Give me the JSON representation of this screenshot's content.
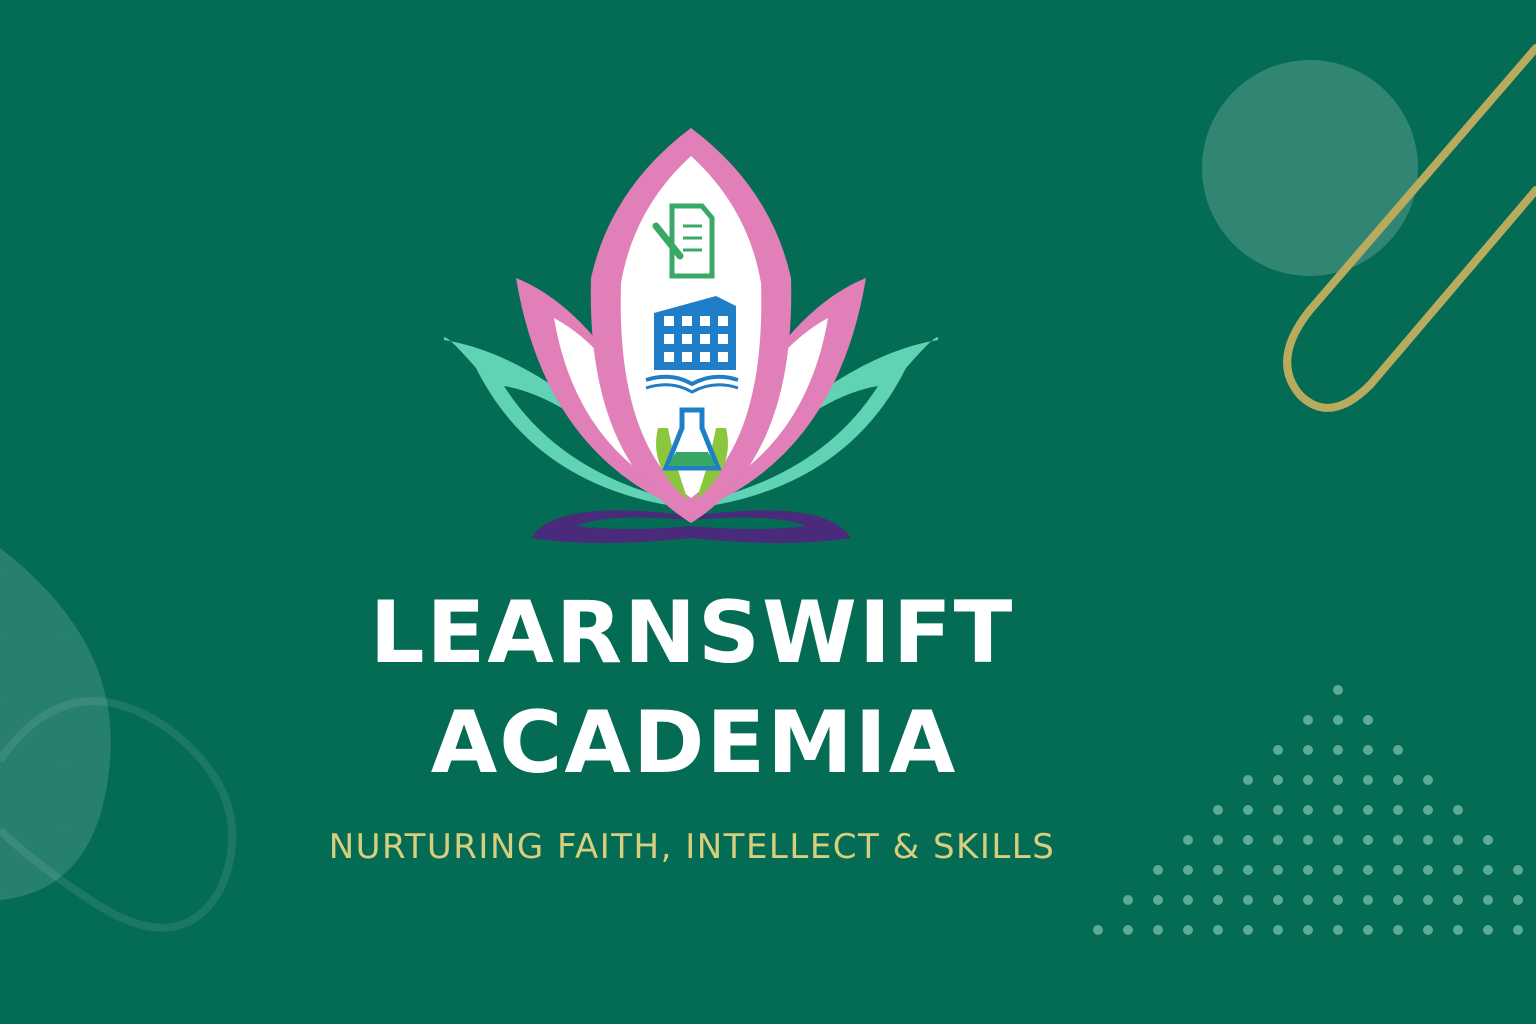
{
  "brand": {
    "name_line1": "LEARNSWIFT",
    "name_line2": "ACADEMIA",
    "tagline": "NURTURING FAITH, INTELLECT & SKILLS"
  },
  "logo": {
    "icons": [
      "document-pen-icon",
      "building-book-icon",
      "flask-leaves-icon"
    ]
  },
  "colors": {
    "background": "#046b55",
    "title": "#ffffff",
    "tagline": "#d8cf7e",
    "petal_pink": "#e07fb8",
    "petal_teal": "#5fd3b3",
    "base_purple": "#4a2a7a",
    "accent_gold": "#b9ab5e"
  }
}
